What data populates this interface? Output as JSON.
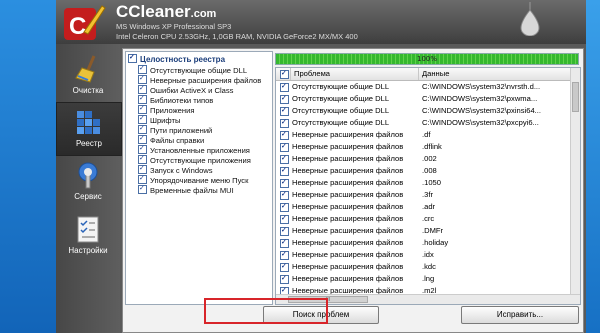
{
  "app": {
    "brand": "CCleaner",
    "brand_suffix": ".com",
    "sys_os": "MS Windows XP Professional SP3",
    "sys_hw": "Intel Celeron CPU 2.53GHz, 1,0GB RAM, NVIDIA GeForce2 MX/MX 400"
  },
  "sidebar": {
    "items": [
      {
        "label": "Очистка",
        "icon": "broom-icon"
      },
      {
        "label": "Реестр",
        "icon": "registry-cubes-icon",
        "active": true
      },
      {
        "label": "Сервис",
        "icon": "wrench-icon"
      },
      {
        "label": "Настройки",
        "icon": "checklist-icon"
      }
    ]
  },
  "tree": {
    "title": "Целостность реестра",
    "items": [
      "Отсутствующие общие DLL",
      "Неверные расширения файлов",
      "Ошибки ActiveX и Class",
      "Библиотеки типов",
      "Приложения",
      "Шрифты",
      "Пути приложений",
      "Файлы справки",
      "Установленные приложения",
      "Отсутствующие приложения",
      "Запуск с Windows",
      "Упорядочивание меню Пуск",
      "Временные файлы MUI"
    ]
  },
  "progress": {
    "label": "100%",
    "value": 1.0,
    "color": "#3cbc2f"
  },
  "grid": {
    "col_problem": "Проблема",
    "col_data": "Данные",
    "rows": [
      {
        "problem": "Отсутствующие общие DLL",
        "data": "C:\\WINDOWS\\system32\\nvrsth.d..."
      },
      {
        "problem": "Отсутствующие общие DLL",
        "data": "C:\\WINDOWS\\system32\\pxwma..."
      },
      {
        "problem": "Отсутствующие общие DLL",
        "data": "C:\\WINDOWS\\system32\\pxinsi64..."
      },
      {
        "problem": "Отсутствующие общие DLL",
        "data": "C:\\WINDOWS\\system32\\pxcpyi6..."
      },
      {
        "problem": "Неверные расширения файлов",
        "data": ".df"
      },
      {
        "problem": "Неверные расширения файлов",
        "data": ".dflink"
      },
      {
        "problem": "Неверные расширения файлов",
        "data": ".002"
      },
      {
        "problem": "Неверные расширения файлов",
        "data": ".008"
      },
      {
        "problem": "Неверные расширения файлов",
        "data": ".1050"
      },
      {
        "problem": "Неверные расширения файлов",
        "data": ".3fr"
      },
      {
        "problem": "Неверные расширения файлов",
        "data": ".adr"
      },
      {
        "problem": "Неверные расширения файлов",
        "data": ".crc"
      },
      {
        "problem": "Неверные расширения файлов",
        "data": ".DMFr"
      },
      {
        "problem": "Неверные расширения файлов",
        "data": ".holiday"
      },
      {
        "problem": "Неверные расширения файлов",
        "data": ".idx"
      },
      {
        "problem": "Неверные расширения файлов",
        "data": ".kdc"
      },
      {
        "problem": "Неверные расширения файлов",
        "data": ".lng"
      },
      {
        "problem": "Неверные расширения файлов",
        "data": ".m2l"
      }
    ],
    "hscroll_grip": "III"
  },
  "buttons": {
    "scan": "Поиск проблем",
    "fix": "Исправить..."
  },
  "colors": {
    "highlight": "#d8252a",
    "accent": "#1a3d7a"
  }
}
